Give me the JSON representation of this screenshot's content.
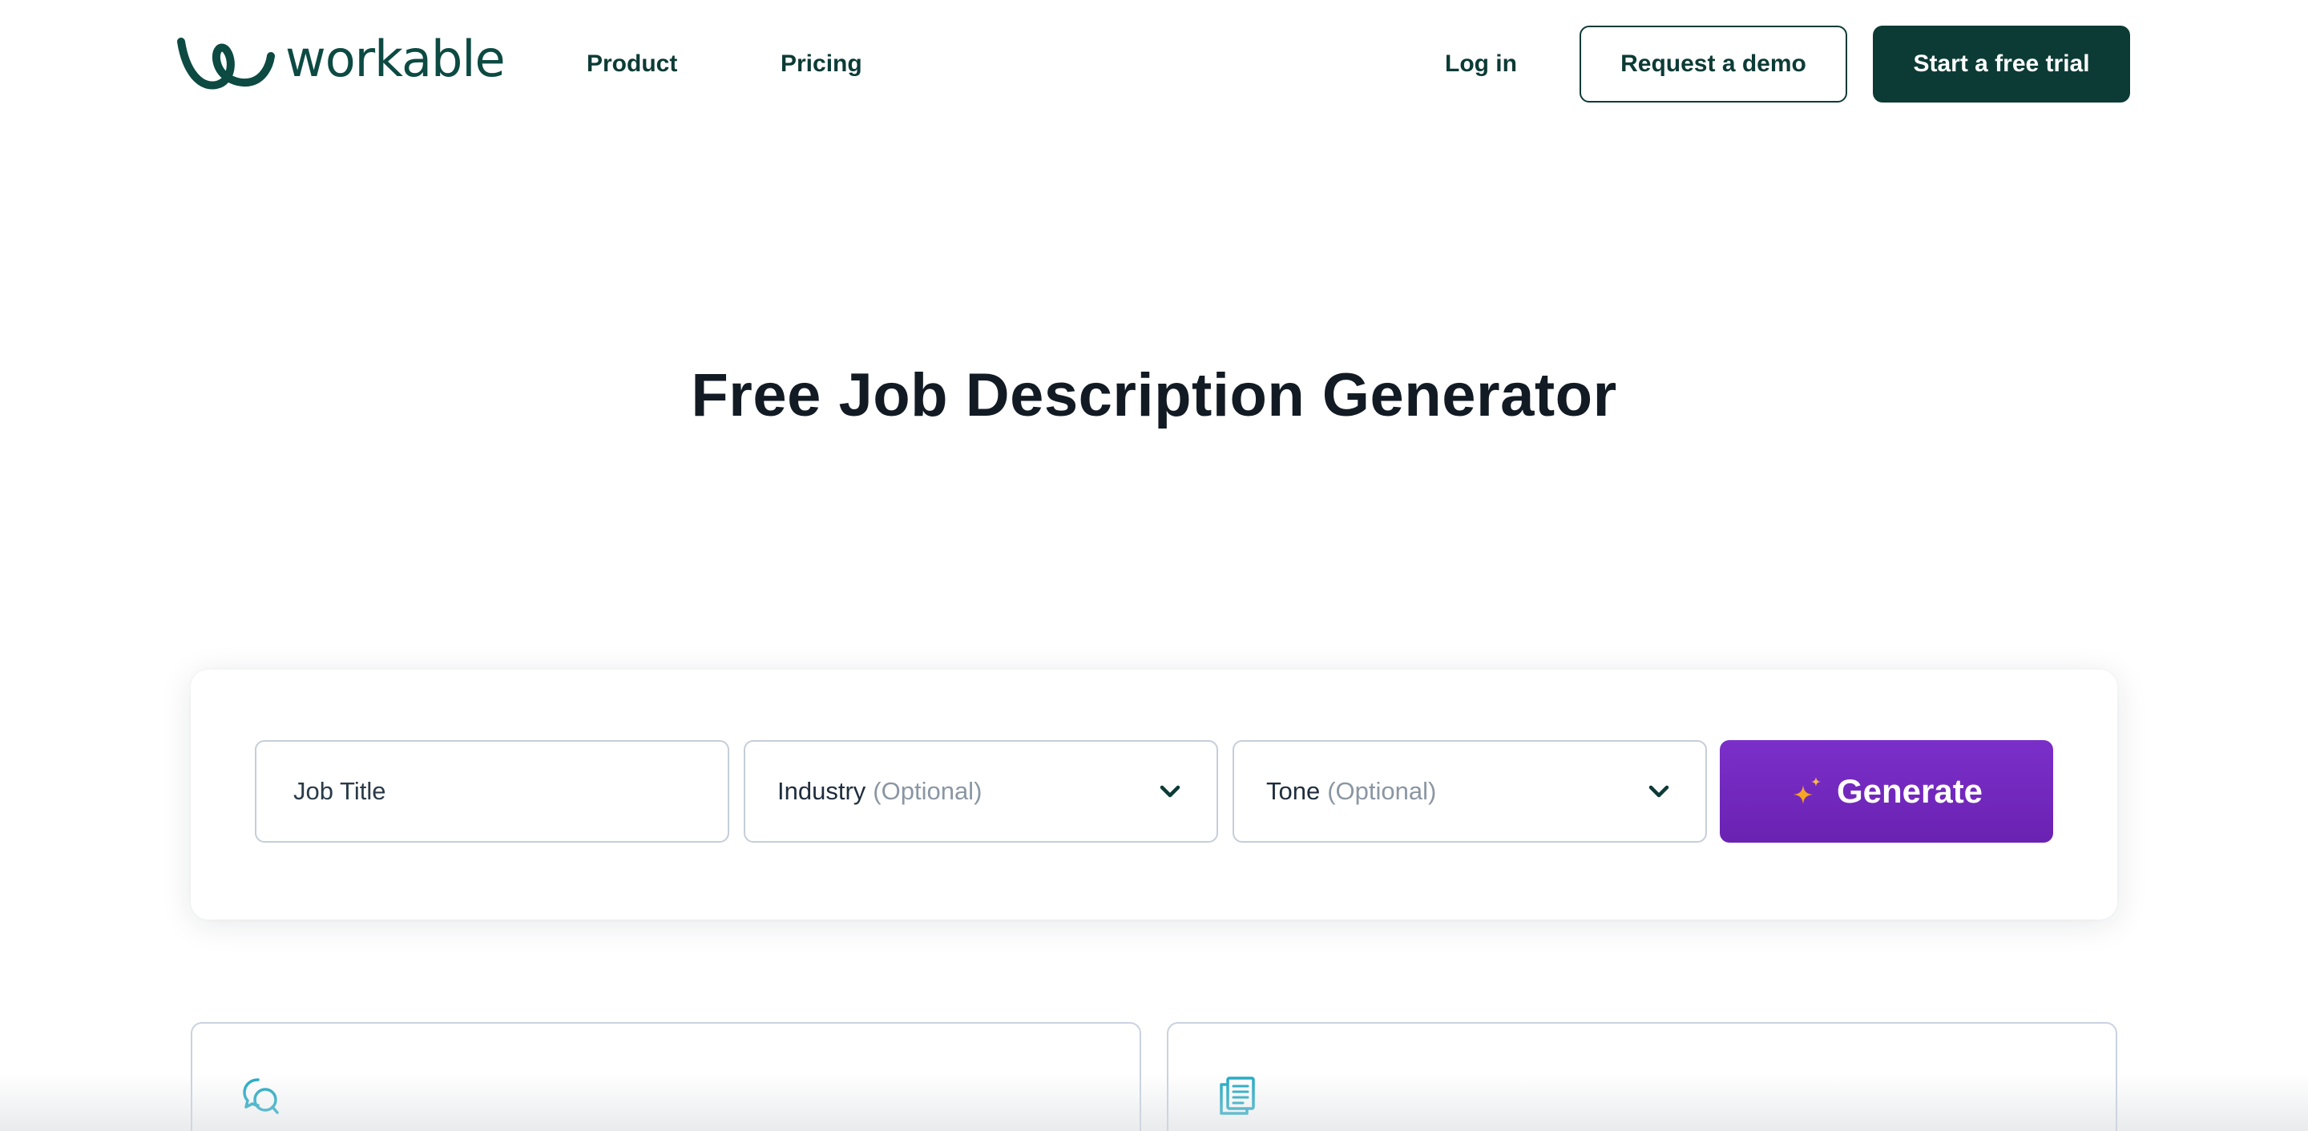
{
  "brand": {
    "name": "workable",
    "color": "#0c3b36",
    "logo_color": "#0c4a42"
  },
  "nav": {
    "product": "Product",
    "pricing": "Pricing",
    "login": "Log in",
    "demo": "Request a demo",
    "trial": "Start a free trial"
  },
  "hero": {
    "title": "Free Job Description Generator"
  },
  "generator": {
    "job_title_placeholder": "Job Title",
    "industry_label": "Industry",
    "industry_optional": "(Optional)",
    "tone_label": "Tone",
    "tone_optional": "(Optional)",
    "generate_label": "Generate",
    "button_color": "#7b2fc9",
    "sparkle_color": "#f5a623"
  },
  "features": [
    {
      "icon": "chat-bubbles-icon",
      "color": "#1fa9c4"
    },
    {
      "icon": "documents-icon",
      "color": "#1fa9c4"
    }
  ]
}
